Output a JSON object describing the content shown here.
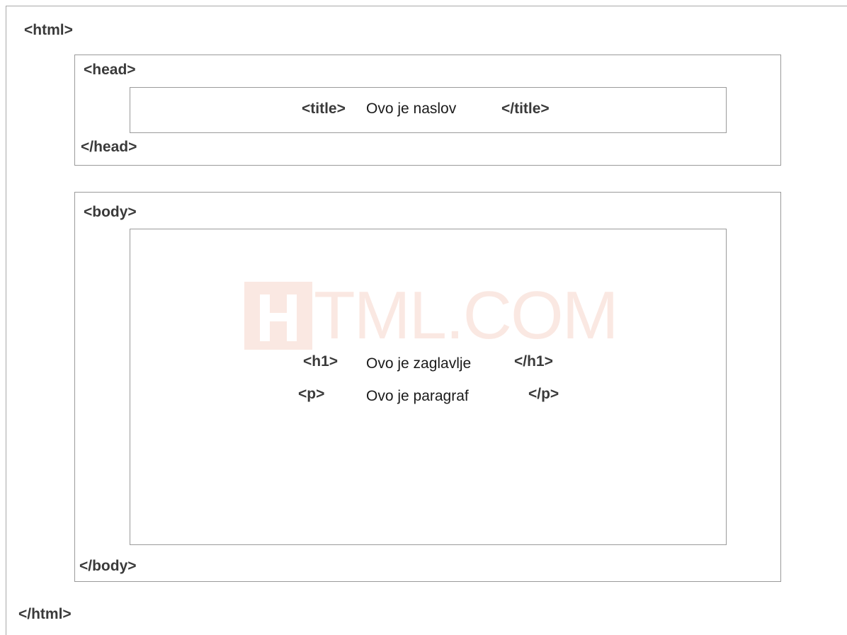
{
  "html_open": "<html>",
  "html_close": "</html>",
  "head": {
    "open": "<head>",
    "close": "</head>",
    "title_open": "<title>",
    "title_text": "Ovo je naslov",
    "title_close": "</title>"
  },
  "body": {
    "open": "<body>",
    "close": "</body>",
    "h1_open": "<h1>",
    "h1_text": "Ovo je zaglavlje",
    "h1_close": "</h1>",
    "p_open": "<p>",
    "p_text": "Ovo je paragraf",
    "p_close": "</p>"
  },
  "watermark": {
    "text": "TML.COM",
    "color": "#e0552b"
  }
}
